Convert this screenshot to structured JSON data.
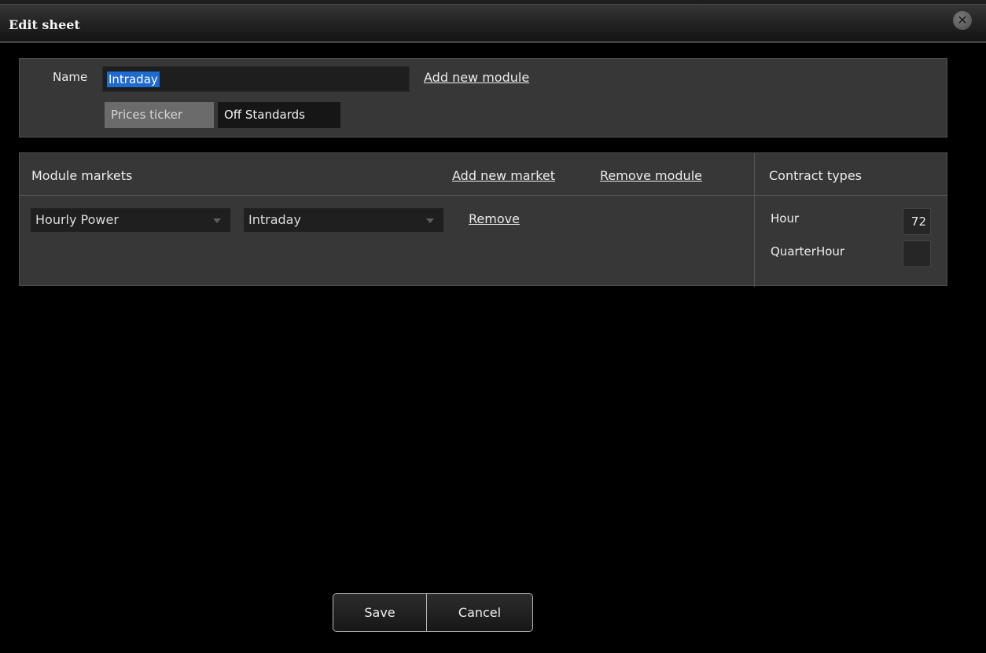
{
  "dialog": {
    "title": "Edit sheet",
    "close_icon": "close-icon"
  },
  "sheet": {
    "name_label": "Name",
    "name_value": "Intraday",
    "add_module_label": "Add new module",
    "tabs": [
      {
        "label": "Prices ticker",
        "state": "inactive"
      },
      {
        "label": "Off Standards",
        "state": "active"
      }
    ]
  },
  "module": {
    "title": "Module markets",
    "add_market_label": "Add new market",
    "remove_module_label": "Remove module",
    "markets": [
      {
        "market": "Hourly Power",
        "type": "Intraday",
        "remove_label": "Remove"
      }
    ]
  },
  "contract_types": {
    "title": "Contract types",
    "items": [
      {
        "label": "Hour",
        "value": "72"
      },
      {
        "label": "QuarterHour",
        "value": ""
      }
    ]
  },
  "footer": {
    "save_label": "Save",
    "cancel_label": "Cancel"
  },
  "colors": {
    "background": "#000000",
    "panel": "#373737",
    "selection": "#1e6bd0"
  }
}
